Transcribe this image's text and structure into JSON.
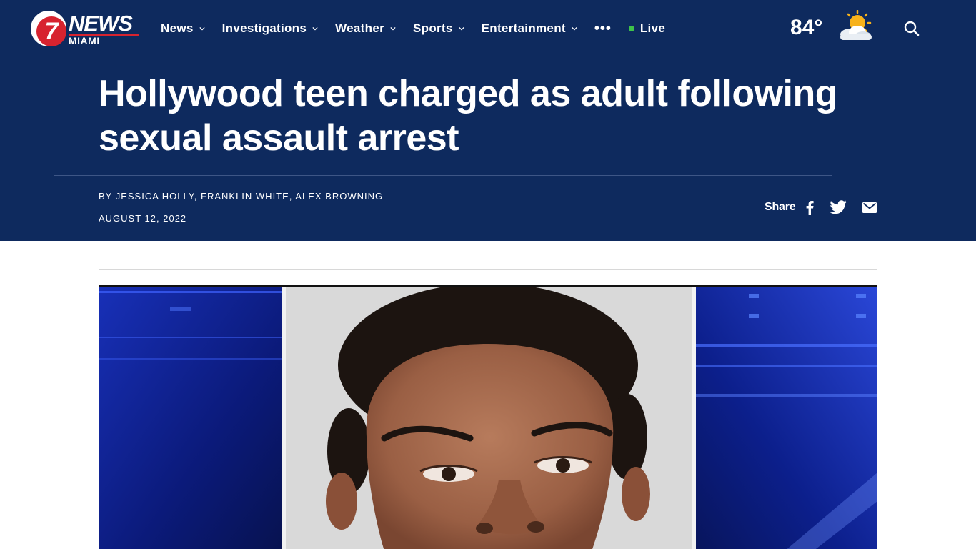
{
  "brand": {
    "number": "7",
    "name": "NEWS",
    "city": "MIAMI",
    "accent_red": "#d7232f",
    "navy": "#0e2a5e"
  },
  "nav": {
    "items": [
      {
        "label": "News",
        "has_dropdown": true
      },
      {
        "label": "Investigations",
        "has_dropdown": true
      },
      {
        "label": "Weather",
        "has_dropdown": true
      },
      {
        "label": "Sports",
        "has_dropdown": true
      },
      {
        "label": "Entertainment",
        "has_dropdown": true
      }
    ],
    "more": "•••",
    "live": "Live",
    "live_color": "#3ec34a"
  },
  "weather": {
    "temperature": "84°",
    "icon": "partly-sunny-icon"
  },
  "article": {
    "headline": "Hollywood teen charged as adult following sexual assault arrest",
    "byline": "BY JESSICA HOLLY, FRANKLIN WHITE, ALEX BROWNING",
    "date": "AUGUST 12, 2022",
    "share_label": "Share"
  }
}
